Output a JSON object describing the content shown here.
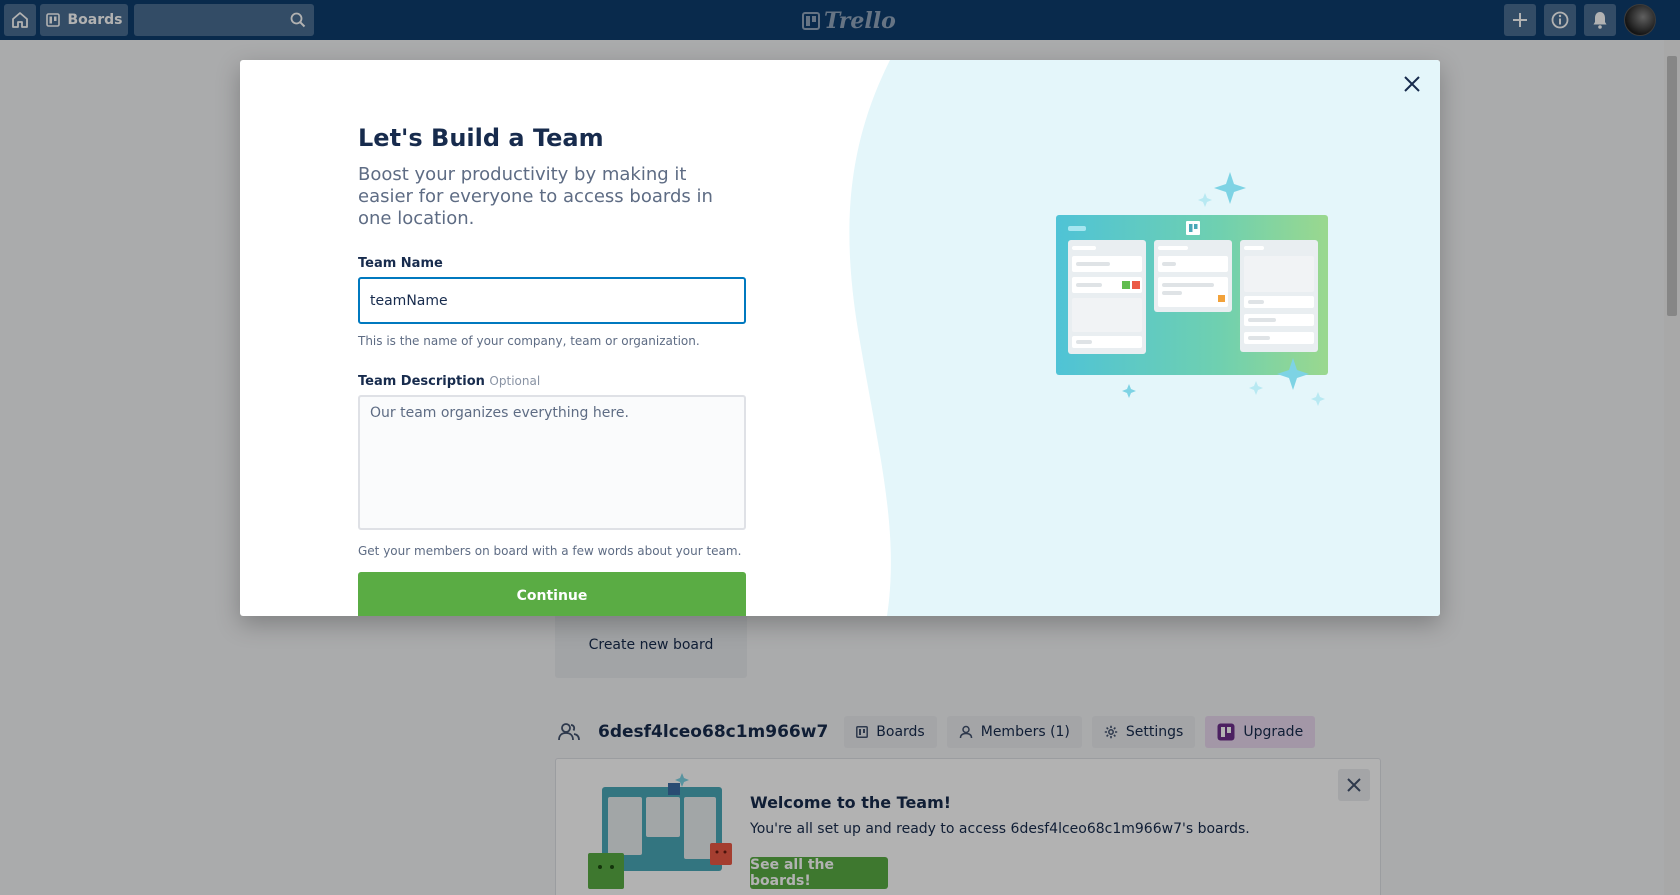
{
  "header": {
    "boards_label": "Boards",
    "search_value": "",
    "logo_text": "Trello"
  },
  "background": {
    "create_board_label": "Create new board",
    "team": {
      "name": "6desf4lceo68c1m966w7",
      "tabs": [
        {
          "label": "Boards",
          "icon": "board-icon"
        },
        {
          "label": "Members (1)",
          "icon": "person-icon"
        },
        {
          "label": "Settings",
          "icon": "gear-icon"
        },
        {
          "label": "Upgrade",
          "icon": "upgrade-icon"
        }
      ]
    },
    "welcome": {
      "title": "Welcome to the Team!",
      "text": "You're all set up and ready to access 6desf4lceo68c1m966w7's boards.",
      "button_label": "See all the boards!"
    }
  },
  "modal": {
    "title": "Let's Build a Team",
    "subtitle": "Boost your productivity by making it easier for everyone to access boards in one location.",
    "team_name_label": "Team Name",
    "team_name_value": "teamName",
    "team_name_hint": "This is the name of your company, team or organization.",
    "team_desc_label": "Team Description",
    "team_desc_optional": "Optional",
    "team_desc_placeholder": "Our team organizes everything here.",
    "team_desc_hint": "Get your members on board with a few words about your team.",
    "continue_label": "Continue"
  },
  "colors": {
    "header": "#0e3d6e",
    "primary_green": "#5aac44",
    "input_focus": "#0079bf",
    "illustration_bg": "#e4f6fa"
  }
}
